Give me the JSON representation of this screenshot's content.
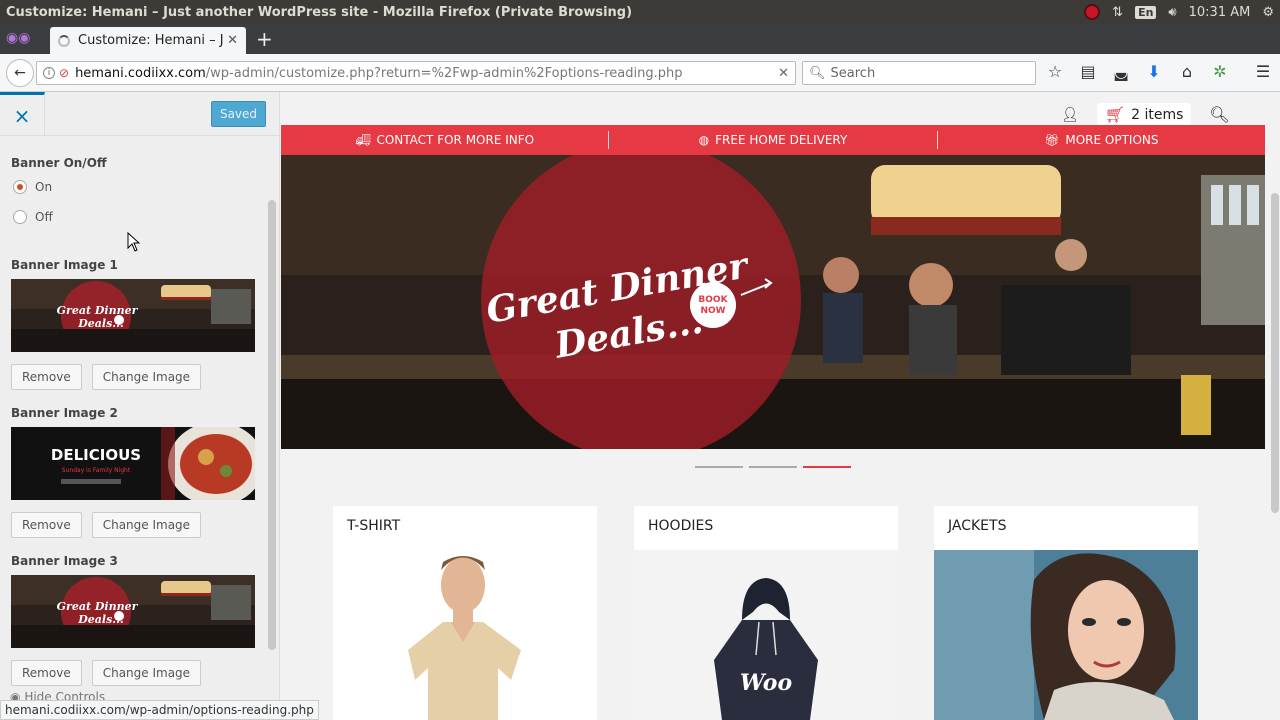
{
  "window": {
    "title": "Customize: Hemani – Just another WordPress site - Mozilla Firefox (Private Browsing)",
    "tray_lang": "En",
    "clock": "10:31 AM"
  },
  "browser": {
    "tab_title": "Customize: Hemani – Ju",
    "url_host": "hemani.codiixx.com",
    "url_path": "/wp-admin/customize.php?return=%2Fwp-admin%2Foptions-reading.php",
    "search_placeholder": "Search",
    "status_url": "hemani.codiixx.com/wp-admin/options-reading.php"
  },
  "customizer": {
    "close_label": "×",
    "saved_label": "Saved",
    "banner_toggle_title": "Banner On/Off",
    "options": [
      "On",
      "Off"
    ],
    "selected": "On",
    "banners": [
      {
        "label": "Banner Image 1",
        "remove": "Remove",
        "change": "Change Image",
        "image": "great-dinner-deals"
      },
      {
        "label": "Banner Image 2",
        "remove": "Remove",
        "change": "Change Image",
        "image": "delicious-sunday"
      },
      {
        "label": "Banner Image 3",
        "remove": "Remove",
        "change": "Change Image",
        "image": "great-dinner-deals"
      }
    ],
    "thumb2_heading": "DELICIOUS",
    "thumb2_sub": "Sunday is Family Night",
    "hide_controls": "Hide Controls"
  },
  "site": {
    "cart_label": "2 items",
    "promo": [
      "CONTACT FOR MORE INFO",
      "FREE HOME DELIVERY",
      "MORE OPTIONS"
    ],
    "hero_line1": "Great Dinner",
    "hero_line2": "Deals...",
    "hero_badge_1": "BOOK",
    "hero_badge_2": "NOW",
    "slider_active": 3,
    "categories": [
      "T-SHIRT",
      "HOODIES",
      "JACKETS"
    ],
    "hoodie_text": "Woo"
  },
  "colors": {
    "accent_red": "#e53943",
    "wp_blue": "#0073aa",
    "radio_checked": "#d54e21"
  }
}
